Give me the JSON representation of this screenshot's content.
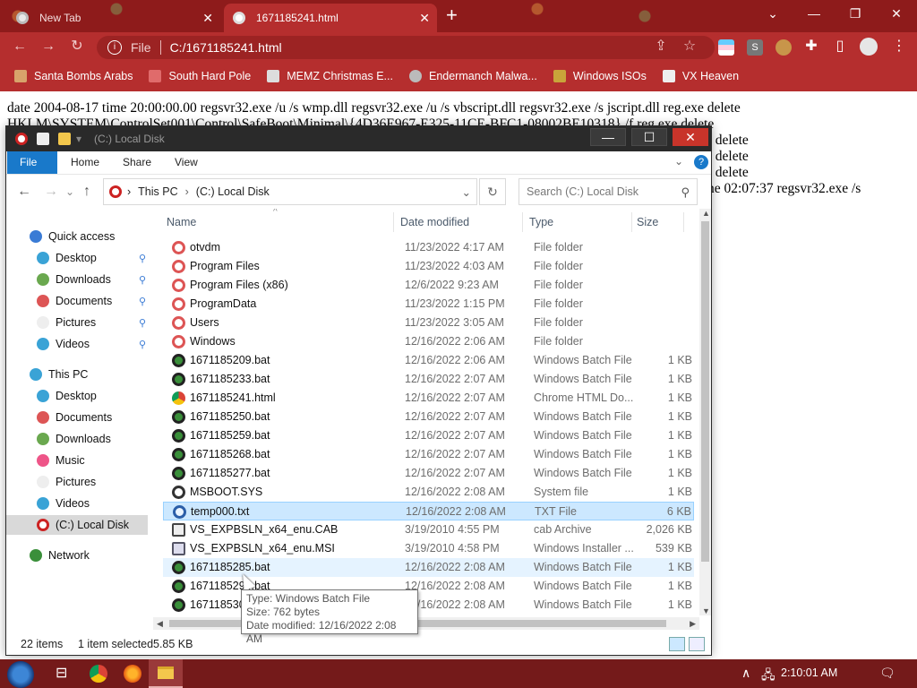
{
  "browser": {
    "tabs": [
      {
        "title": "New Tab"
      },
      {
        "title": "1671185241.html"
      }
    ],
    "address": {
      "prefix": "File",
      "url": "C:/1671185241.html"
    },
    "bookmarks": [
      {
        "label": "Santa Bombs Arabs"
      },
      {
        "label": "South Hard Pole"
      },
      {
        "label": "MEMZ Christmas E..."
      },
      {
        "label": "Endermanch Malwa..."
      },
      {
        "label": "Windows ISOs"
      },
      {
        "label": "VX Heaven"
      }
    ],
    "extension_label": "S",
    "page_lines": [
      "date 2004-08-17 time 20:00:00.00 regsvr32.exe /u /s wmp.dll regsvr32.exe /u /s vbscript.dll regsvr32.exe /s jscript.dll reg.exe delete",
      "HKLM\\SYSTEM\\ControlSet001\\Control\\SafeBoot\\Minimal\\{4D36E967-E325-11CE-BFC1-08002BE10318} /f reg.exe delete",
      "e delete",
      "e delete",
      "e delete",
      "ne 02:07:37 regsvr32.exe /s"
    ]
  },
  "explorer": {
    "title": "(C:) Local Disk",
    "ribbon_tabs": [
      "File",
      "Home",
      "Share",
      "View"
    ],
    "breadcrumb": [
      "This PC",
      "(C:) Local Disk"
    ],
    "search_placeholder": "Search (C:) Local Disk",
    "nav": {
      "quick_access": "Quick access",
      "quick_items": [
        "Desktop",
        "Downloads",
        "Documents",
        "Pictures",
        "Videos"
      ],
      "this_pc": "This PC",
      "pc_items": [
        "Desktop",
        "Documents",
        "Downloads",
        "Music",
        "Pictures",
        "Videos",
        "(C:) Local Disk"
      ],
      "network": "Network"
    },
    "columns": [
      "Name",
      "Date modified",
      "Type",
      "Size"
    ],
    "files": [
      {
        "name": "otvdm",
        "date": "11/23/2022 4:17 AM",
        "type": "File folder",
        "size": "",
        "icon": "folder-icon"
      },
      {
        "name": "Program Files",
        "date": "11/23/2022 4:03 AM",
        "type": "File folder",
        "size": "",
        "icon": "folder-icon"
      },
      {
        "name": "Program Files (x86)",
        "date": "12/6/2022 9:23 AM",
        "type": "File folder",
        "size": "",
        "icon": "folder-icon"
      },
      {
        "name": "ProgramData",
        "date": "11/23/2022 1:15 PM",
        "type": "File folder",
        "size": "",
        "icon": "folder-icon"
      },
      {
        "name": "Users",
        "date": "11/23/2022 3:05 AM",
        "type": "File folder",
        "size": "",
        "icon": "folder-icon"
      },
      {
        "name": "Windows",
        "date": "12/16/2022 2:06 AM",
        "type": "File folder",
        "size": "",
        "icon": "folder-icon"
      },
      {
        "name": "1671185209.bat",
        "date": "12/16/2022 2:06 AM",
        "type": "Windows Batch File",
        "size": "1 KB",
        "icon": "batch-file-icon"
      },
      {
        "name": "1671185233.bat",
        "date": "12/16/2022 2:07 AM",
        "type": "Windows Batch File",
        "size": "1 KB",
        "icon": "batch-file-icon"
      },
      {
        "name": "1671185241.html",
        "date": "12/16/2022 2:07 AM",
        "type": "Chrome HTML Do...",
        "size": "1 KB",
        "icon": "chrome-icon"
      },
      {
        "name": "1671185250.bat",
        "date": "12/16/2022 2:07 AM",
        "type": "Windows Batch File",
        "size": "1 KB",
        "icon": "batch-file-icon"
      },
      {
        "name": "1671185259.bat",
        "date": "12/16/2022 2:07 AM",
        "type": "Windows Batch File",
        "size": "1 KB",
        "icon": "batch-file-icon"
      },
      {
        "name": "1671185268.bat",
        "date": "12/16/2022 2:07 AM",
        "type": "Windows Batch File",
        "size": "1 KB",
        "icon": "batch-file-icon"
      },
      {
        "name": "1671185277.bat",
        "date": "12/16/2022 2:07 AM",
        "type": "Windows Batch File",
        "size": "1 KB",
        "icon": "batch-file-icon"
      },
      {
        "name": "MSBOOT.SYS",
        "date": "12/16/2022 2:08 AM",
        "type": "System file",
        "size": "1 KB",
        "icon": "system-file-icon"
      },
      {
        "name": "temp000.txt",
        "date": "12/16/2022 2:08 AM",
        "type": "TXT File",
        "size": "6 KB",
        "icon": "text-file-icon",
        "state": "selected"
      },
      {
        "name": "VS_EXPBSLN_x64_enu.CAB",
        "date": "3/19/2010 4:55 PM",
        "type": "cab Archive",
        "size": "2,026 KB",
        "icon": "cab-archive-icon"
      },
      {
        "name": "VS_EXPBSLN_x64_enu.MSI",
        "date": "3/19/2010 4:58 PM",
        "type": "Windows Installer ...",
        "size": "539 KB",
        "icon": "installer-icon"
      },
      {
        "name": "1671185285.bat",
        "date": "12/16/2022 2:08 AM",
        "type": "Windows Batch File",
        "size": "1 KB",
        "icon": "batch-file-icon",
        "state": "hover"
      },
      {
        "name": "1671185294.bat",
        "date": "12/16/2022 2:08 AM",
        "type": "Windows Batch File",
        "size": "1 KB",
        "icon": "batch-file-icon"
      },
      {
        "name": "1671185303.bat",
        "date": "12/16/2022 2:08 AM",
        "type": "Windows Batch File",
        "size": "1 KB",
        "icon": "batch-file-icon"
      }
    ],
    "status": {
      "count": "22 items",
      "selected": "1 item selected",
      "size": "5.85 KB"
    },
    "tooltip": [
      "Type: Windows Batch File",
      "Size: 762 bytes",
      "Date modified: 12/16/2022 2:08 AM"
    ]
  },
  "taskbar": {
    "clock": "2:10:01 AM"
  },
  "colors": {
    "chrome_red": "#b52e2e",
    "ribbon_blue": "#1979ca",
    "selection": "#cce8ff",
    "taskbar": "#741a1a"
  }
}
